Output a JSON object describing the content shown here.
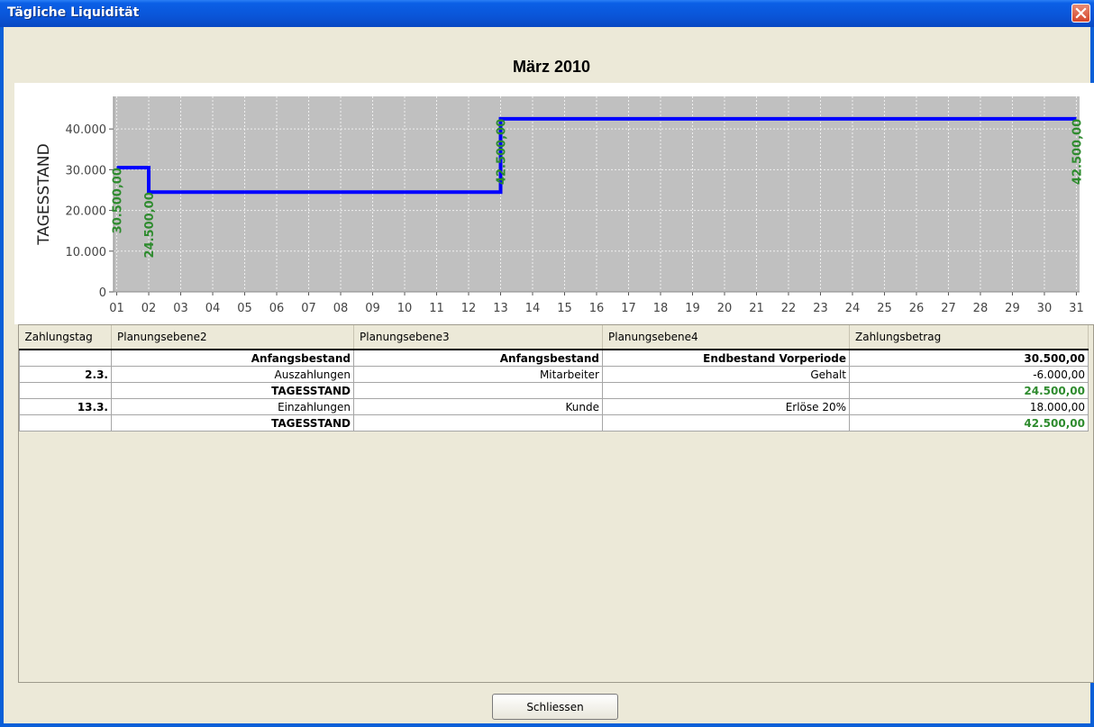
{
  "window": {
    "title": "Tägliche Liquidität",
    "close_icon": "close-icon"
  },
  "header": {
    "month": "März 2010"
  },
  "chart_data": {
    "type": "line",
    "ylabel": "TAGESSTAND",
    "xlabel": "",
    "x_ticks": [
      "01",
      "02",
      "03",
      "04",
      "05",
      "06",
      "07",
      "08",
      "09",
      "10",
      "11",
      "12",
      "13",
      "14",
      "15",
      "16",
      "17",
      "18",
      "19",
      "20",
      "21",
      "22",
      "23",
      "24",
      "25",
      "26",
      "27",
      "28",
      "29",
      "30",
      "31"
    ],
    "y_ticks": [
      "0",
      "10.000",
      "20.000",
      "30.000",
      "40.000"
    ],
    "ylim": [
      0,
      48000
    ],
    "xlim": [
      0.9,
      31.1
    ],
    "step": true,
    "grid": true,
    "series": [
      {
        "points": [
          [
            1,
            30500
          ],
          [
            2,
            30500
          ],
          [
            2,
            24500
          ],
          [
            13,
            24500
          ],
          [
            13,
            42500
          ],
          [
            31,
            42500
          ]
        ],
        "color": "#0000ff"
      }
    ],
    "annotations": [
      {
        "day": 1,
        "value": 30500,
        "label": "30.500,00"
      },
      {
        "day": 2,
        "value": 24500,
        "label": "24.500,00"
      },
      {
        "day": 13,
        "value": 42500,
        "label": "42.500,00"
      },
      {
        "day": 31,
        "value": 42500,
        "label": "42.500,00"
      }
    ],
    "annotation_color": "#2e8b2e",
    "plot_background": "#c0c0c0"
  },
  "table": {
    "columns": [
      "Zahlungstag",
      "Planungsebene2",
      "Planungsebene3",
      "Planungsebene4",
      "Zahlungsbetrag"
    ],
    "rows": [
      {
        "tag": "",
        "e2": "Anfangsbestand",
        "e3": "Anfangsbestand",
        "e4": "Endbestand Vorperiode",
        "betrag": "30.500,00",
        "bold": true
      },
      {
        "tag": "2.3.",
        "e2": "Auszahlungen",
        "e3": "Mitarbeiter",
        "e4": "Gehalt",
        "betrag": "-6.000,00"
      },
      {
        "tag": "",
        "e2": "TAGESSTAND",
        "e3": "",
        "e4": "",
        "betrag": "24.500,00",
        "total": true
      },
      {
        "tag": "13.3.",
        "e2": "Einzahlungen",
        "e3": "Kunde",
        "e4": "Erlöse 20%",
        "betrag": "18.000,00"
      },
      {
        "tag": "",
        "e2": "TAGESSTAND",
        "e3": "",
        "e4": "",
        "betrag": "42.500,00",
        "total": true
      }
    ]
  },
  "footer": {
    "close_label": "Schliessen"
  }
}
